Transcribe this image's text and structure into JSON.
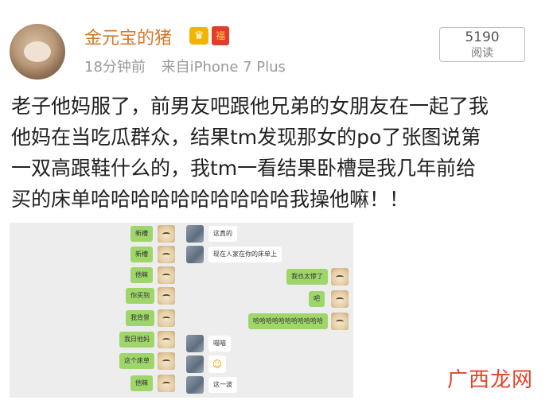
{
  "post": {
    "username": "金元宝的猪",
    "time": "18分钟前",
    "source": "来自iPhone 7 Plus",
    "read_count": "5190",
    "read_label": "阅读",
    "text_lines": [
      "老子他妈服了，前男友吧跟他兄弟的女朋友在一起了我",
      "他妈在当吃瓜群众，结果tm发现那女的po了张图说第",
      "一双高跟鞋什么的，我tm一看结果卧槽是我几年前给",
      "买的床单哈哈哈哈哈哈哈哈哈哈我操他嘛！！"
    ]
  },
  "chat": {
    "left_green": [
      "新槽",
      "新槽",
      "他嘛",
      "你买到",
      "我背景",
      "我日他妈",
      "这个床单",
      "他嘛"
    ],
    "right_white": [
      "这真的",
      "现在人家在你的床单上",
      "喵喵",
      "这一波"
    ],
    "right_green": [
      "我也太惨了",
      "吧",
      "哈哈哈哈哈哈哈哈哈哈哈"
    ]
  },
  "icons": {
    "vip": "crown-badge-icon",
    "red": "red-packet-icon"
  },
  "watermark": "广西龙网"
}
